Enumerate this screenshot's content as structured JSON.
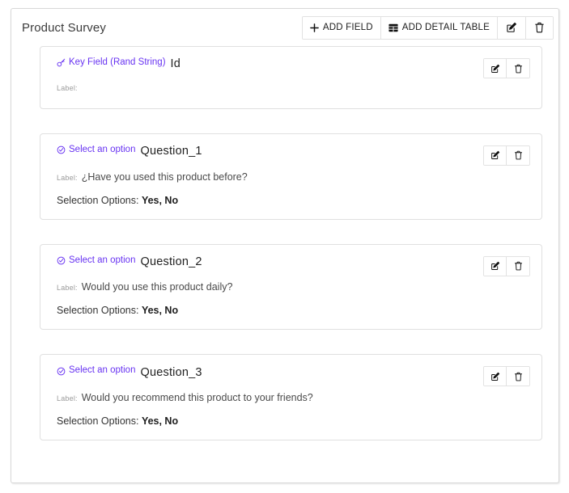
{
  "panel": {
    "title": "Product Survey",
    "actions": [
      {
        "id": "add-field",
        "label": "ADD FIELD",
        "icon": "plus-icon"
      },
      {
        "id": "add-detail-table",
        "label": "ADD DETAIL TABLE",
        "icon": "table-icon"
      },
      {
        "id": "edit-entity",
        "label": "",
        "icon": "edit-icon"
      },
      {
        "id": "delete-entity",
        "label": "",
        "icon": "trash-icon"
      }
    ]
  },
  "row_actions": {
    "edit": {
      "icon": "edit-icon",
      "title": "Edit"
    },
    "delete": {
      "icon": "trash-icon",
      "title": "Delete"
    }
  },
  "labels": {
    "label_key": "Label:",
    "options_key": "Selection Options:"
  },
  "colors": {
    "accent": "#6833f2",
    "text": "#222222",
    "muted": "#9a9a9a",
    "border": "#e0e0e0"
  },
  "fields": [
    {
      "type_label": "Key Field (Rand String)",
      "type_icon": "key-icon",
      "name": "Id",
      "label_key": "Label:",
      "label_value": "",
      "has_options": false,
      "options_key": "",
      "options_value": ""
    },
    {
      "type_label": "Select an option",
      "type_icon": "check-circle-icon",
      "name": "Question_1",
      "label_key": "Label:",
      "label_value": "¿Have you used this product before?",
      "has_options": true,
      "options_key": "Selection Options:",
      "options_value": "Yes, No"
    },
    {
      "type_label": "Select an option",
      "type_icon": "check-circle-icon",
      "name": "Question_2",
      "label_key": "Label:",
      "label_value": "Would you use this product daily?",
      "has_options": true,
      "options_key": "Selection Options:",
      "options_value": "Yes, No"
    },
    {
      "type_label": "Select an option",
      "type_icon": "check-circle-icon",
      "name": "Question_3",
      "label_key": "Label:",
      "label_value": "Would you recommend this product to your friends?",
      "has_options": true,
      "options_key": "Selection Options:",
      "options_value": "Yes, No"
    }
  ]
}
